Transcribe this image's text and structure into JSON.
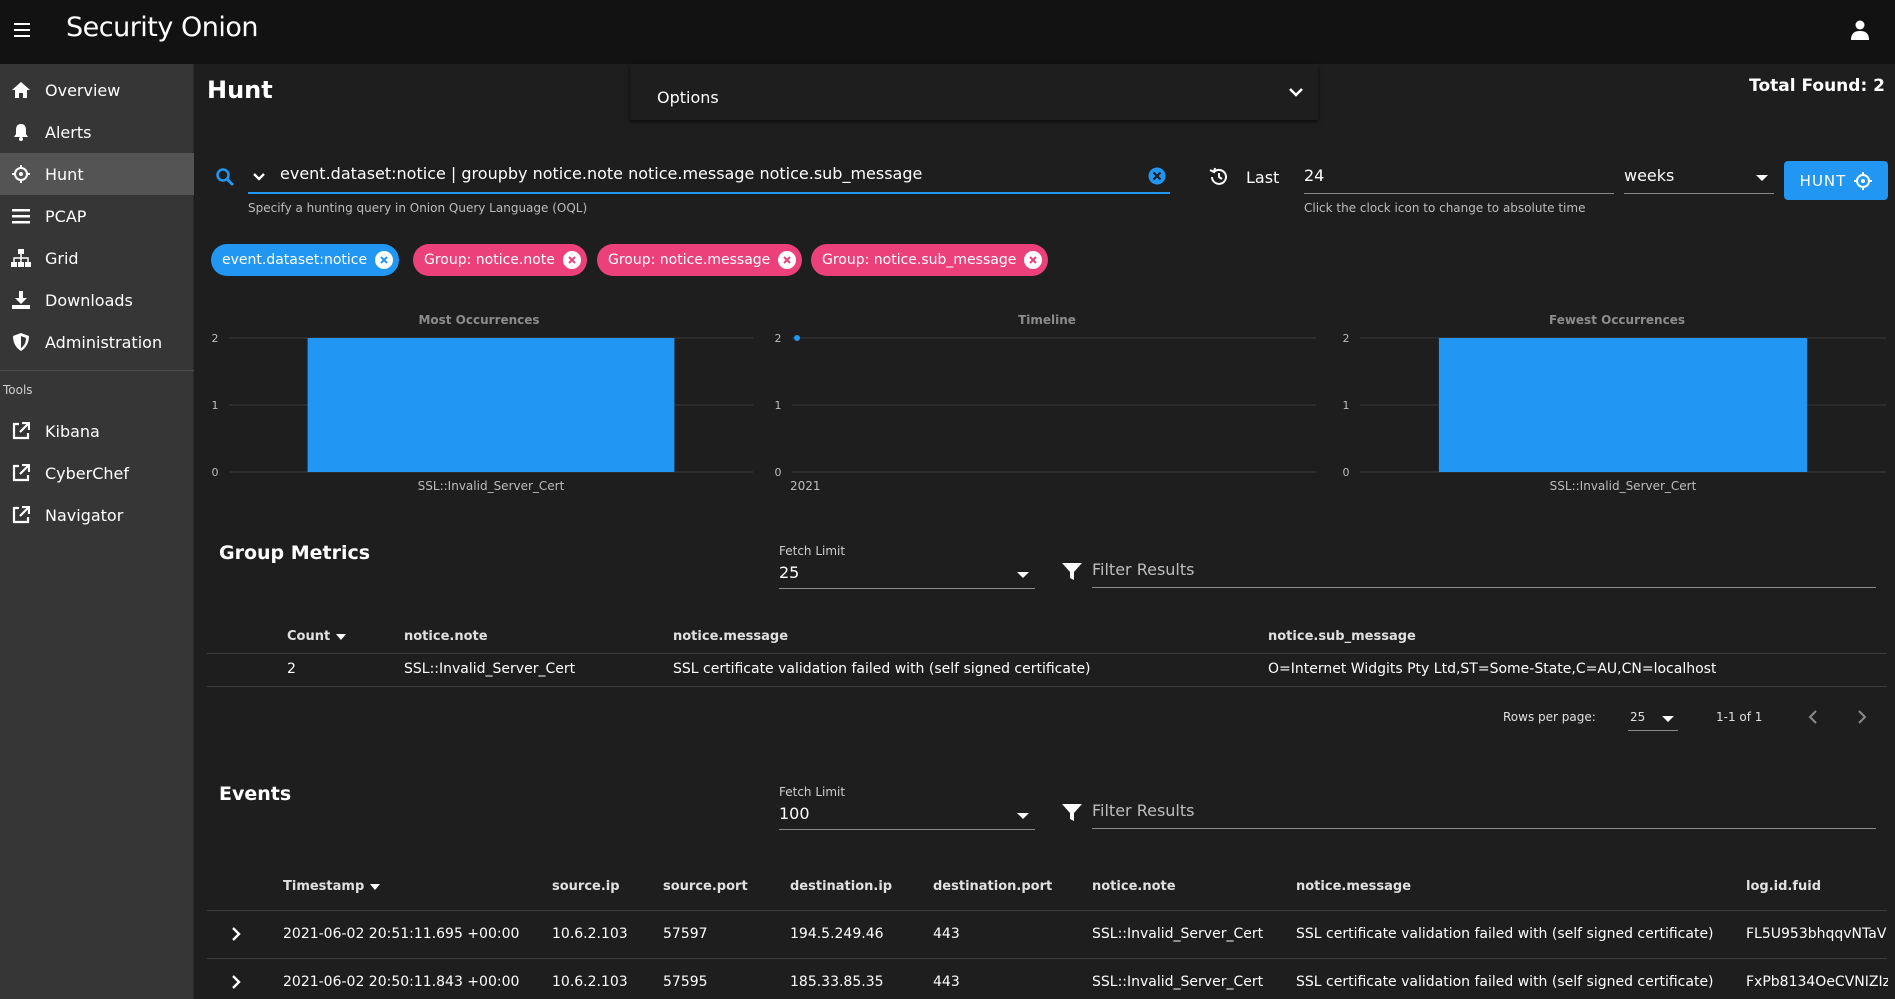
{
  "app": {
    "logo_text": "Security Onion"
  },
  "header": {
    "menu_icon": "hamburger-icon",
    "user_icon": "account-icon"
  },
  "sidebar": {
    "items": [
      {
        "label": "Overview",
        "icon": "home-icon"
      },
      {
        "label": "Alerts",
        "icon": "bell-icon"
      },
      {
        "label": "Hunt",
        "icon": "crosshairs-icon",
        "active": true
      },
      {
        "label": "PCAP",
        "icon": "list-icon"
      },
      {
        "label": "Grid",
        "icon": "sitemap-icon"
      },
      {
        "label": "Downloads",
        "icon": "download-icon"
      },
      {
        "label": "Administration",
        "icon": "shield-icon"
      }
    ],
    "tools_header": "Tools",
    "tools": [
      {
        "label": "Kibana",
        "icon": "external-link-icon"
      },
      {
        "label": "CyberChef",
        "icon": "external-link-icon"
      },
      {
        "label": "Navigator",
        "icon": "external-link-icon"
      }
    ]
  },
  "main": {
    "title": "Hunt",
    "options_label": "Options",
    "total_found": "Total Found: 2"
  },
  "search": {
    "query": "event.dataset:notice | groupby notice.note notice.message notice.sub_message",
    "hint": "Specify a hunting query in Onion Query Language (OQL)",
    "last_label": "Last",
    "last_value": "24",
    "time_hint": "Click the clock icon to change to absolute time",
    "units": "weeks",
    "hunt_button": "HUNT"
  },
  "chips": [
    {
      "label": "event.dataset:notice",
      "color": "#2196f3"
    },
    {
      "label": "Group: notice.note",
      "color": "#ec407a"
    },
    {
      "label": "Group: notice.message",
      "color": "#ec407a"
    },
    {
      "label": "Group: notice.sub_message",
      "color": "#ec407a"
    }
  ],
  "chart_data": [
    {
      "type": "bar",
      "title": "Most Occurrences",
      "categories": [
        "SSL::Invalid_Server_Cert"
      ],
      "values": [
        2
      ],
      "ylim": [
        0,
        2
      ],
      "yticks": [
        "0",
        "1",
        "2"
      ],
      "color": "#2196f3"
    },
    {
      "type": "scatter",
      "title": "Timeline",
      "x": [
        "2021"
      ],
      "values": [
        2
      ],
      "ylim": [
        0,
        2
      ],
      "yticks": [
        "0",
        "1",
        "2"
      ],
      "color": "#2196f3"
    },
    {
      "type": "bar",
      "title": "Fewest Occurrences",
      "categories": [
        "SSL::Invalid_Server_Cert"
      ],
      "values": [
        2
      ],
      "ylim": [
        0,
        2
      ],
      "yticks": [
        "0",
        "1",
        "2"
      ],
      "color": "#2196f3"
    }
  ],
  "group_metrics": {
    "title": "Group Metrics",
    "fetch_label": "Fetch Limit",
    "fetch_value": "25",
    "filter_placeholder": "Filter Results",
    "columns": [
      "Count",
      "notice.note",
      "notice.message",
      "notice.sub_message"
    ],
    "rows": [
      [
        "2",
        "SSL::Invalid_Server_Cert",
        "SSL certificate validation failed with (self signed certificate)",
        "O=Internet Widgits Pty Ltd,ST=Some-State,C=AU,CN=localhost"
      ]
    ],
    "rows_per_page_label": "Rows per page:",
    "rows_per_page": "25",
    "page_info": "1-1 of 1"
  },
  "events": {
    "title": "Events",
    "fetch_label": "Fetch Limit",
    "fetch_value": "100",
    "filter_placeholder": "Filter Results",
    "columns": [
      "Timestamp",
      "source.ip",
      "source.port",
      "destination.ip",
      "destination.port",
      "notice.note",
      "notice.message",
      "log.id.fuid"
    ],
    "rows": [
      [
        "2021-06-02 20:51:11.695 +00:00",
        "10.6.2.103",
        "57597",
        "194.5.249.46",
        "443",
        "SSL::Invalid_Server_Cert",
        "SSL certificate validation failed with (self signed certificate)",
        "FL5U953bhqqvNTaV"
      ],
      [
        "2021-06-02 20:50:11.843 +00:00",
        "10.6.2.103",
        "57595",
        "185.33.85.35",
        "443",
        "SSL::Invalid_Server_Cert",
        "SSL certificate validation failed with (self signed certificate)",
        "FxPb8134OeCVNIZIz"
      ]
    ]
  }
}
